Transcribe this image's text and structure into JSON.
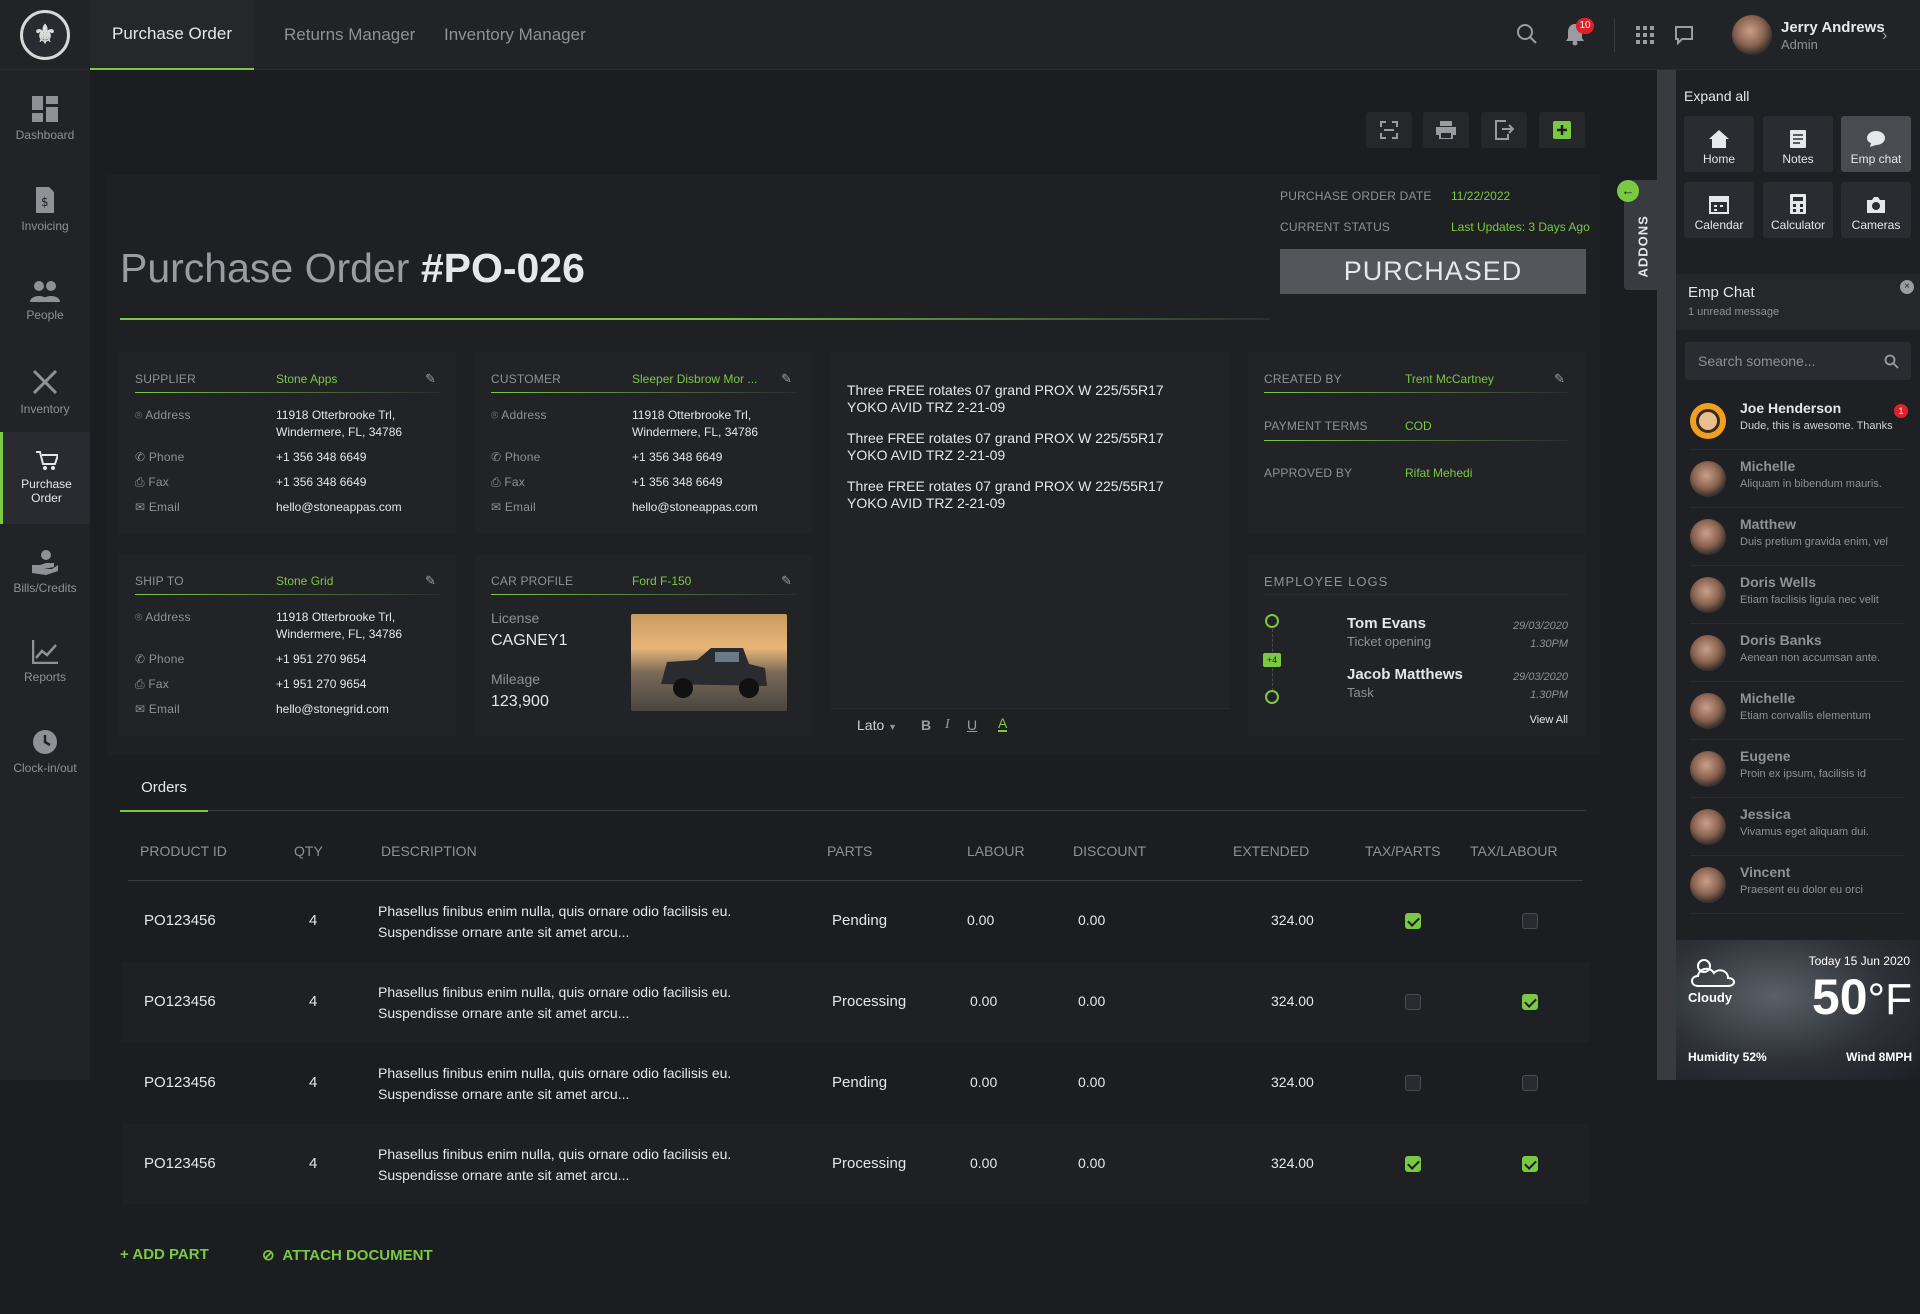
{
  "topbar": {
    "tabs": [
      "Purchase Order",
      "Returns Manager",
      "Inventory Manager"
    ],
    "notification_count": "10",
    "user_name": "Jerry Andrews",
    "user_role": "Admin"
  },
  "sidebar": {
    "items": [
      {
        "label": "Dashboard"
      },
      {
        "label": "Invoicing"
      },
      {
        "label": "People"
      },
      {
        "label": "Inventory"
      },
      {
        "label": "Purchase Order"
      },
      {
        "label": "Bills/Credits"
      },
      {
        "label": "Reports"
      },
      {
        "label": "Clock-in/out"
      }
    ]
  },
  "po": {
    "title_prefix": "Purchase Order",
    "number": "#PO-026",
    "date_label": "PURCHASE ORDER DATE",
    "date_value": "11/22/2022",
    "status_label": "CURRENT STATUS",
    "status_updated": "Last Updates: 3 Days Ago",
    "status": "PURCHASED",
    "addons_label": "ADDONS"
  },
  "supplier": {
    "label": "SUPPLIER",
    "name": "Stone Apps",
    "address_label": "Address",
    "address_1": "11918 Otterbrooke Trl,",
    "address_2": "Windermere, FL, 34786",
    "phone_label": "Phone",
    "phone": "+1 356 348 6649",
    "fax_label": "Fax",
    "fax": "+1 356 348 6649",
    "email_label": "Email",
    "email": "hello@stoneappas.com"
  },
  "customer": {
    "label": "CUSTOMER",
    "name": "Sleeper Disbrow Mor ...",
    "address_label": "Address",
    "address_1": "11918 Otterbrooke Trl,",
    "address_2": "Windermere, FL, 34786",
    "phone_label": "Phone",
    "phone": "+1 356 348 6649",
    "fax_label": "Fax",
    "fax": "+1 356 348 6649",
    "email_label": "Email",
    "email": "hello@stoneappas.com"
  },
  "ship_to": {
    "label": "SHIP TO",
    "name": "Stone Grid",
    "address_label": "Address",
    "address_1": "11918 Otterbrooke Trl,",
    "address_2": "Windermere, FL, 34786",
    "phone_label": "Phone",
    "phone": "+1 951 270 9654",
    "fax_label": "Fax",
    "fax": "+1 951 270 9654",
    "email_label": "Email",
    "email": "hello@stonegrid.com"
  },
  "car": {
    "label": "CAR PROFILE",
    "name": "Ford F-150",
    "license_label": "License",
    "license": "CAGNEY1",
    "mileage_label": "Mileage",
    "mileage": "123,900"
  },
  "notes": {
    "lines": [
      [
        "Three FREE rotates 07 grand PROX W 225/55R17",
        "YOKO AVID TRZ 2-21-09"
      ],
      [
        "Three FREE rotates 07 grand PROX W 225/55R17",
        "YOKO AVID TRZ 2-21-09"
      ],
      [
        "Three FREE rotates 07 grand PROX W 225/55R17",
        "YOKO AVID TRZ 2-21-09"
      ]
    ],
    "font": "Lato",
    "bold": "B",
    "italic": "I",
    "underline": "U",
    "color": "A"
  },
  "meta": {
    "created_label": "CREATED BY",
    "created_value": "Trent McCartney",
    "terms_label": "PAYMENT TERMS",
    "terms_value": "COD",
    "approved_label": "APPROVED BY",
    "approved_value": "Rifat Mehedi"
  },
  "logs": {
    "label": "EMPLOYEE LOGS",
    "more": "+4",
    "entries": [
      {
        "name": "Tom Evans",
        "action": "Ticket opening",
        "date": "29/03/2020",
        "time": "1.30PM"
      },
      {
        "name": "Jacob Matthews",
        "action": "Task",
        "date": "29/03/2020",
        "time": "1.30PM"
      }
    ],
    "view_all": "View All"
  },
  "orders": {
    "tab": "Orders",
    "headers": [
      "PRODUCT ID",
      "QTY",
      "DESCRIPTION",
      "PARTS",
      "LABOUR",
      "DISCOUNT",
      "EXTENDED",
      "TAX/PARTS",
      "TAX/LABOUR"
    ],
    "rows": [
      {
        "id": "PO123456",
        "qty": "4",
        "desc_1": "Phasellus finibus enim nulla, quis ornare odio facilisis eu.",
        "desc_2": "Suspendisse ornare ante sit amet arcu...",
        "parts": "Pending",
        "labour": "0.00",
        "discount": "0.00",
        "extended": "324.00",
        "tax_parts": true,
        "tax_labour": false
      },
      {
        "id": "PO123456",
        "qty": "4",
        "desc_1": "Phasellus finibus enim nulla, quis ornare odio facilisis eu.",
        "desc_2": "Suspendisse ornare ante sit amet arcu...",
        "parts": "Processing",
        "labour": "0.00",
        "discount": "0.00",
        "extended": "324.00",
        "tax_parts": false,
        "tax_labour": true
      },
      {
        "id": "PO123456",
        "qty": "4",
        "desc_1": "Phasellus finibus enim nulla, quis ornare odio facilisis eu.",
        "desc_2": "Suspendisse ornare ante sit amet arcu...",
        "parts": "Pending",
        "labour": "0.00",
        "discount": "0.00",
        "extended": "324.00",
        "tax_parts": false,
        "tax_labour": false
      },
      {
        "id": "PO123456",
        "qty": "4",
        "desc_1": "Phasellus finibus enim nulla, quis ornare odio facilisis eu.",
        "desc_2": "Suspendisse ornare ante sit amet arcu...",
        "parts": "Processing",
        "labour": "0.00",
        "discount": "0.00",
        "extended": "324.00",
        "tax_parts": true,
        "tax_labour": true
      }
    ],
    "add_part": "+ ADD PART",
    "attach": "ATTACH DOCUMENT"
  },
  "panel": {
    "expand_all": "Expand all",
    "tiles": [
      "Home",
      "Notes",
      "Emp chat",
      "Calendar",
      "Calculator",
      "Cameras"
    ],
    "chat_title": "Emp Chat",
    "chat_sub": "1 unread message",
    "search_placeholder": "Search someone...",
    "contacts": [
      {
        "name": "Joe Henderson",
        "msg": "Dude, this is awesome. Thanks",
        "badge": "1"
      },
      {
        "name": "Michelle",
        "msg": "Aliquam in bibendum mauris."
      },
      {
        "name": "Matthew",
        "msg": "Duis pretium gravida enim, vel"
      },
      {
        "name": "Doris Wells",
        "msg": "Etiam facilisis ligula nec velit"
      },
      {
        "name": "Doris Banks",
        "msg": "Aenean non accumsan ante."
      },
      {
        "name": "Michelle",
        "msg": "Etiam convallis elementum"
      },
      {
        "name": "Eugene",
        "msg": "Proin ex ipsum, facilisis id"
      },
      {
        "name": "Jessica",
        "msg": "Vivamus eget aliquam dui."
      },
      {
        "name": "Vincent",
        "msg": "Praesent eu dolor eu orci"
      }
    ],
    "weather": {
      "date": "Today 15 Jun 2020",
      "condition": "Cloudy",
      "temp": "50",
      "unit": "°F",
      "humidity": "Humidity 52%",
      "wind": "Wind 8MPH"
    }
  },
  "colors": {
    "accent": "#7ac943",
    "bg": "#1c1d21",
    "card": "#222327",
    "badge": "#e0202a"
  }
}
